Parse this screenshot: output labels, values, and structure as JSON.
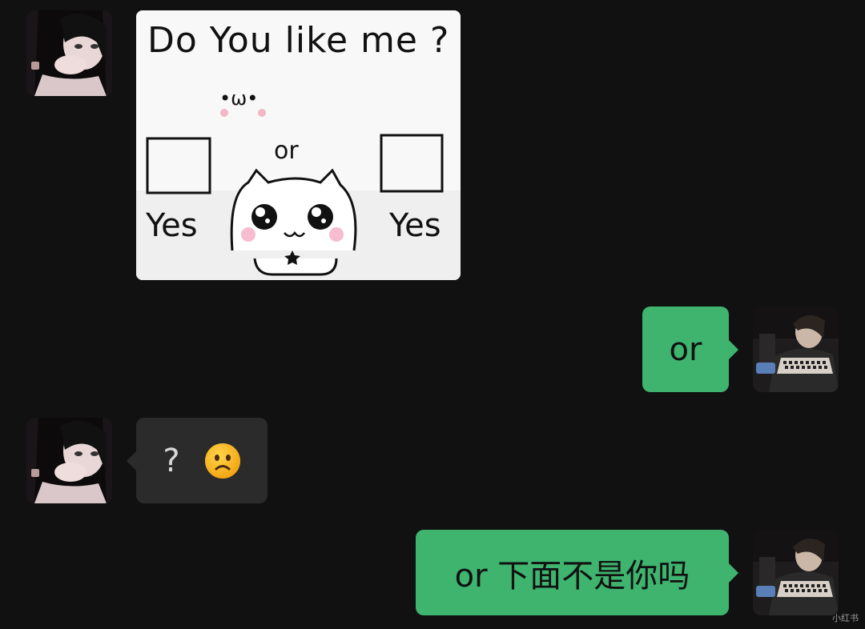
{
  "messages": {
    "image_card": {
      "title": "Do You like me ?",
      "face_text": "•ω•",
      "or_label": "or",
      "left_option": "Yes",
      "right_option": "Yes"
    },
    "reply_or": "or",
    "question_text": "?",
    "question_emoji": "frowning-face",
    "reply_final": "or 下面不是你吗"
  },
  "colors": {
    "background": "#111111",
    "green_bubble": "#3eb46f",
    "dark_bubble": "#2b2b2b"
  },
  "watermark": "小红书"
}
